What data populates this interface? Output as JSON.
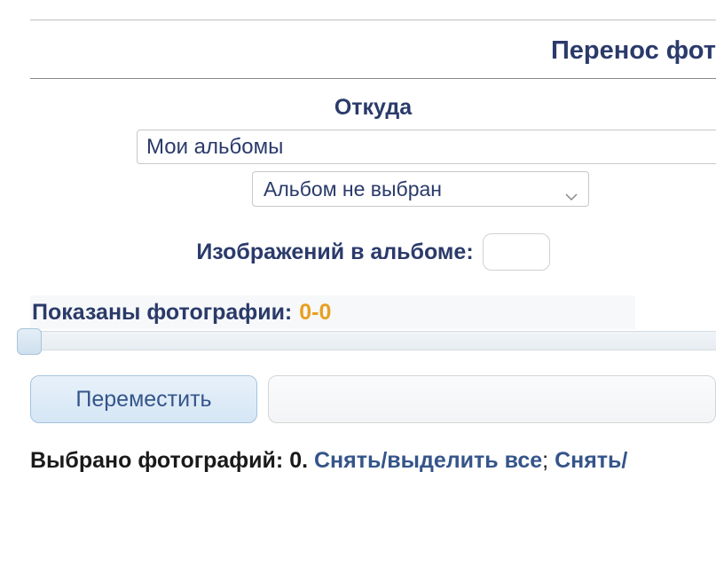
{
  "header": {
    "page_title": "Перенос фот"
  },
  "source": {
    "section_label": "Откуда",
    "my_albums_text": "Мои альбомы",
    "album_select_text": "Альбом не выбран"
  },
  "counts": {
    "images_in_album_label": "Изображений в альбоме:",
    "images_in_album_value": "",
    "shown_label": "Показаны фотографии:",
    "shown_range": "0-0"
  },
  "buttons": {
    "move_label": "Переместить"
  },
  "selection": {
    "selected_label": "Выбрано фотографий: ",
    "selected_count": "0",
    "period": ". ",
    "toggle_all_link": "Снять/выделить все",
    "separator": "; ",
    "toggle_partial_link": "Снять/"
  }
}
